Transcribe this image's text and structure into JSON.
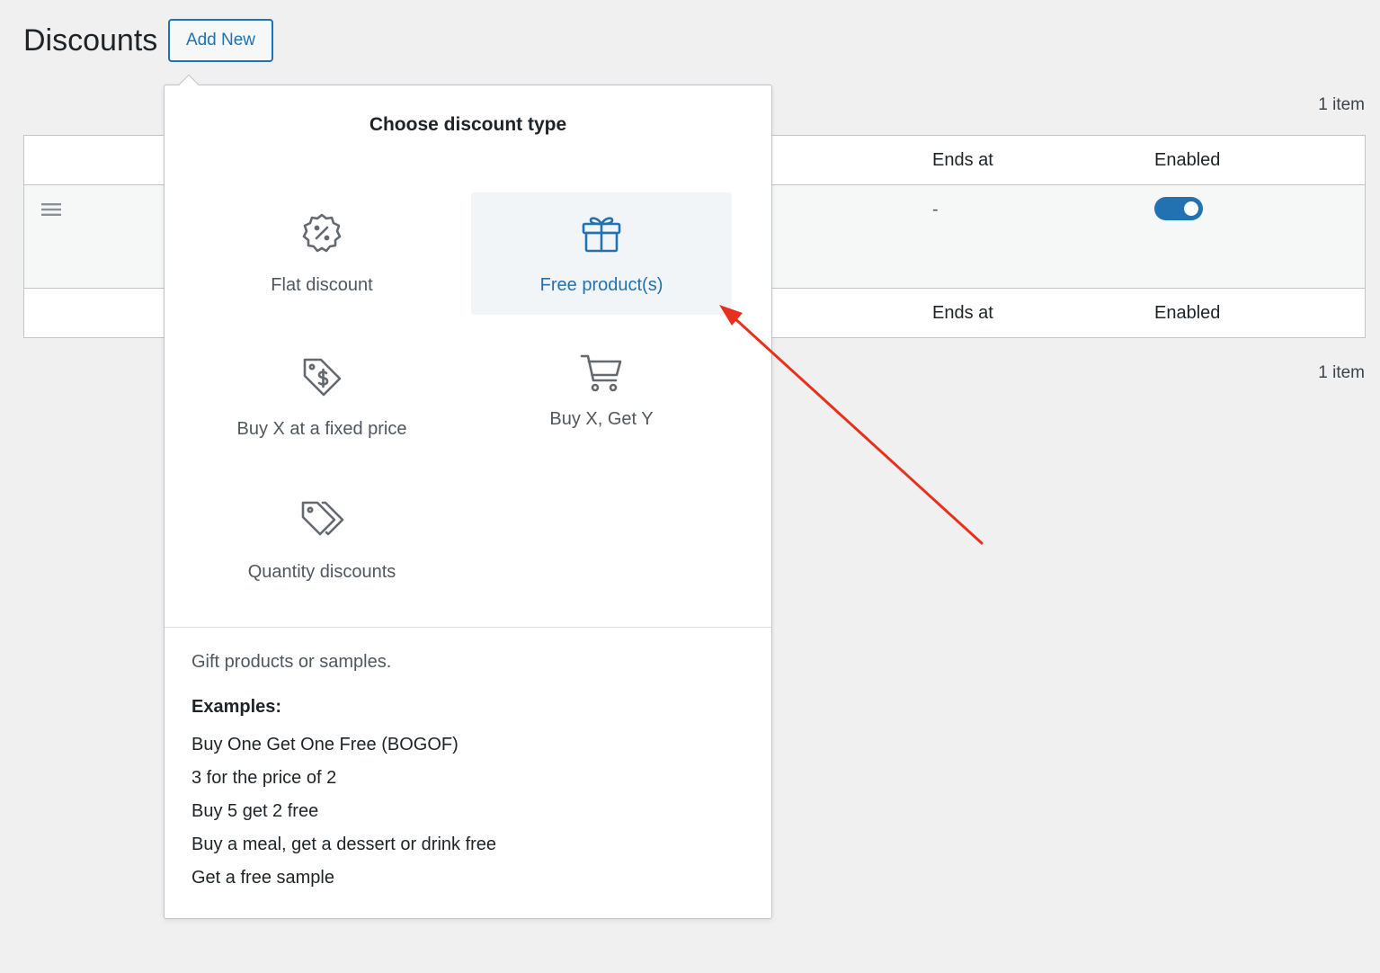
{
  "header": {
    "title": "Discounts",
    "add_new_label": "Add New"
  },
  "list": {
    "item_count_top": "1 item",
    "item_count_bottom": "1 item",
    "columns": [
      "Ends at",
      "Enabled"
    ],
    "footer_columns": [
      "Ends at",
      "Enabled"
    ],
    "rows": [
      {
        "ends_at": "-",
        "enabled": true
      }
    ]
  },
  "popover": {
    "title": "Choose discount type",
    "options": [
      {
        "label": "Flat discount",
        "icon": "percent-badge-icon",
        "selected": false
      },
      {
        "label": "Free product(s)",
        "icon": "gift-icon",
        "selected": true
      },
      {
        "label": "Buy X at a fixed price",
        "icon": "price-tag-dollar-icon",
        "selected": false
      },
      {
        "label": "Buy X, Get Y",
        "icon": "shopping-cart-icon",
        "selected": false
      },
      {
        "label": "Quantity discounts",
        "icon": "tags-icon",
        "selected": false
      }
    ],
    "description": "Gift products or samples.",
    "examples_heading": "Examples:",
    "examples": [
      "Buy One Get One Free (BOGOF)",
      "3 for the price of 2",
      "Buy 5 get 2 free",
      "Buy a meal, get a dessert or drink free",
      "Get a free sample"
    ]
  },
  "colors": {
    "accent": "#2271b1",
    "annotation_arrow": "#e8311c",
    "background": "#f0f0f1"
  }
}
